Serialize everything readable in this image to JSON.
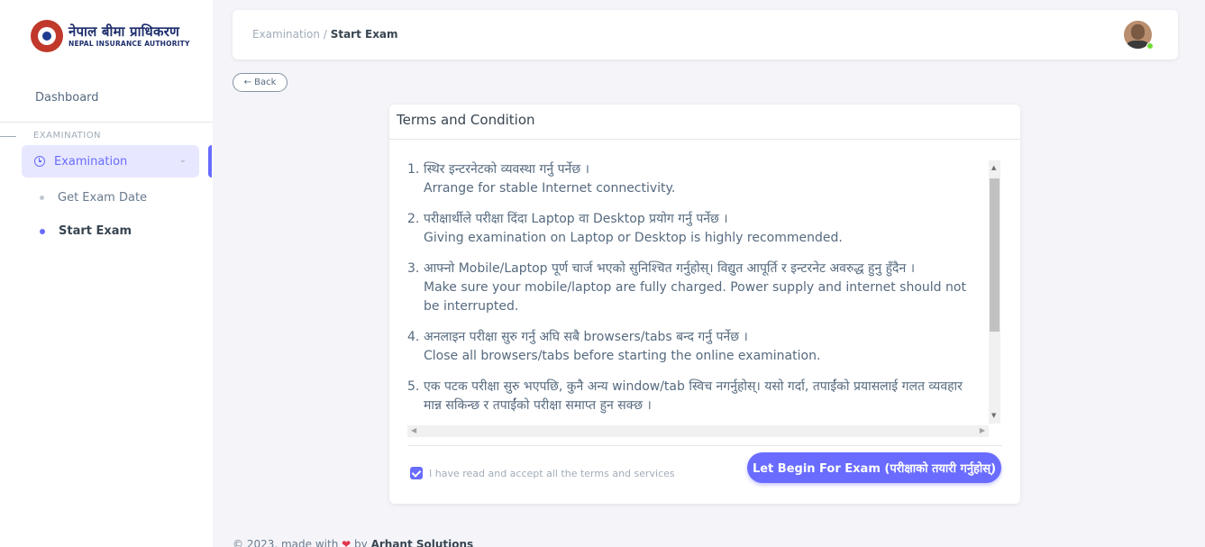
{
  "brand": {
    "name_np": "नेपाल बीमा प्राधिकरण",
    "name_en": "NEPAL INSURANCE AUTHORITY"
  },
  "sidebar": {
    "dashboard_label": "Dashboard",
    "section_label": "EXAMINATION",
    "menu_label": "Examination",
    "sub_items": [
      {
        "label": "Get Exam Date",
        "active": false
      },
      {
        "label": "Start Exam",
        "active": true
      }
    ]
  },
  "header": {
    "breadcrumb_parent": "Examination / ",
    "breadcrumb_current": "Start Exam"
  },
  "back_label": "← Back",
  "card": {
    "title": "Terms and Condition",
    "terms": [
      {
        "num": "1.",
        "np": "स्थिर इन्टरनेटको व्यवस्था गर्नु पर्नेछ ।",
        "en": "Arrange for stable Internet connectivity."
      },
      {
        "num": "2.",
        "np": "परीक्षार्थीले परीक्षा दिंदा Laptop वा Desktop प्रयोग गर्नु पर्नेछ ।",
        "en": "Giving examination on Laptop or Desktop is highly recommended."
      },
      {
        "num": "3.",
        "np": "आफ्नो Mobile/Laptop पूर्ण चार्ज भएको सुनिश्चित गर्नुहोस्। विद्युत आपूर्ति र इन्टरनेट अवरुद्ध हुनु हुँदैन ।",
        "en": "Make sure your mobile/laptop are fully charged. Power supply and internet should not be interrupted."
      },
      {
        "num": "4.",
        "np": "अनलाइन परीक्षा सुरु गर्नु अघि सबै browsers/tabs बन्द गर्नु पर्नेछ ।",
        "en": "Close all browsers/tabs before starting the online examination."
      },
      {
        "num": "5.",
        "np": "एक पटक परीक्षा सुरु भएपछि, कुनै अन्य window/tab स्विच नगर्नुहोस्। यसो गर्दा, तपाईंको प्रयासलाई गलत व्यवहार मान्न सकिन्छ र तपाईंको परीक्षा समाप्त हुन सक्छ ।",
        "en": ""
      }
    ],
    "accept_label": "I have read and accept all the terms and services",
    "accept_checked": true,
    "begin_label": "Let Begin For Exam (परीक्षाको तयारी गर्नुहोस्)"
  },
  "footer": {
    "prefix": "© 2023, made with",
    "by": "by",
    "company": "Arhant Solutions"
  },
  "colors": {
    "primary": "#696cff",
    "background": "#f5f5f9",
    "online": "#71dd37"
  }
}
